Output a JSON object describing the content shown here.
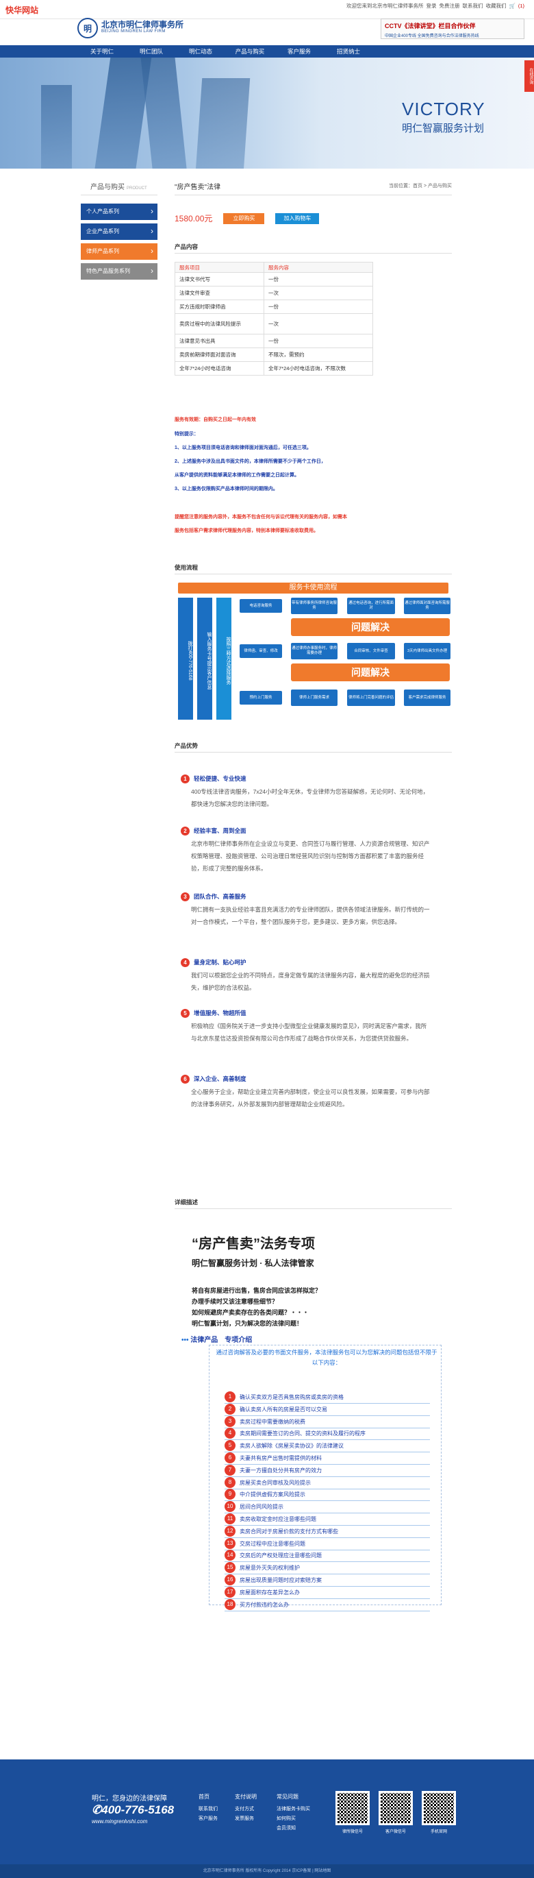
{
  "site_tag": "快华网站",
  "toplinks": [
    "欢迎您来到北京市明仁律师事务所",
    "登录",
    "免费注册",
    "联系我们",
    "收藏我们",
    "(1)"
  ],
  "logo": {
    "mark": "明",
    "cn": "北京市明仁律师事务所",
    "en": "BEIJING MINGREN LAW FIRM"
  },
  "cctv": {
    "title": "CCTV《法律讲堂》栏目合作伙伴",
    "sub": "中国企业400专线 全国免费咨询与合作法律服务热线"
  },
  "nav": [
    "关于明仁",
    "明仁团队",
    "明仁动态",
    "产品与购买",
    "客户服务",
    "招贤纳士"
  ],
  "hero": {
    "title": "VICTORY",
    "subtitle": "明仁智赢服务计划"
  },
  "side_tag": "在线咨询",
  "sidebar": {
    "title": "产品与购买",
    "title_en": "PRODUCT",
    "items": [
      "个人产品系列",
      "企业产品系列",
      "律师产品系列",
      "特色产品服务系列"
    ]
  },
  "breadcrumb": "当前位置：首页 > 产品与购买",
  "product": {
    "title": "\"房产售卖\"法律",
    "price": "1580.00元",
    "buy": "立即购买",
    "cart": "加入购物车"
  },
  "sections": {
    "content": "产品内容",
    "flow": "使用流程",
    "advantage": "产品优势",
    "detail": "详细描述"
  },
  "table": {
    "headers": [
      "服务项目",
      "服务内容"
    ],
    "rows": [
      [
        "法律文书代写",
        "一份"
      ],
      [
        "法律文件审查",
        "一次"
      ],
      [
        "买方违规时职律师函",
        "一份"
      ],
      [
        "卖房过程中的法律风险提示",
        "一次"
      ],
      [
        "法律意见书出具",
        "一份"
      ],
      [
        "卖房前期律师面对面咨询",
        "不限次，需预约"
      ],
      [
        "全年7*24小时电话咨询",
        "全年7*24小时电话咨询，不限次数"
      ]
    ]
  },
  "validity": "服务有效期：自购买之日起一年内有效",
  "notice_title": "特别提示：",
  "notices": [
    "1、以上服务项目须电话咨询和律师面对面沟通后，可任选三项。",
    "2、上述服务中涉及出具书面文件的，本律师所需要不少于两个工作日，",
    "    从客户提供的资料能够满足本律师的工作需要之日起计算。",
    "3、以上服务仅限购买产品本律师时间的期限内。"
  ],
  "disclaimer": [
    "提醒您注意的服务内容外，本服务不包含任何与诉讼代理有关的服务内容，如需本",
    "服务包括客户需求律师代理服务内容，特别本律师要标准收取费用。"
  ],
  "flow": {
    "head": "服务卡使用流程",
    "hotline": "拨打400-776-5168",
    "verify": "输入服务卡号提示客户信息",
    "center": "按照三种方式选择服务",
    "rows": [
      [
        "电话咨询服务",
        "带有律师事务所律师咨询服务",
        "通过电话咨询，进行所需面对",
        "通过律师面对面咨询所需服务"
      ],
      [
        "通过律所提交材料",
        "通过律师办事服务时，律师需要办理",
        "合同审核、文件审查",
        "3天内律师出具文件办理"
      ],
      [
        "预约上门服务",
        "律师上门服务需求",
        "律师将上门完善问题的评估",
        "客户需求完成律师服务"
      ]
    ],
    "side": [
      "文书、合同",
      "律师函、审查、修改"
    ],
    "big": "问题解决"
  },
  "advantages": [
    {
      "n": "1",
      "t": "轻松便捷、专业快速",
      "b": "400专线法律咨询服务，7x24小时全年无休，专业律师为您答疑解惑，无论何时、无论何地，都快速为您解决您的法律问题。"
    },
    {
      "n": "2",
      "t": "经验丰富、周到全面",
      "b": "北京市明仁律师事务所在企业设立与变更、合同签订与履行管理、人力资源合规管理、知识产权策略管理、投融资管理、公司治理日常经营风险识别与控制等方面都积累了丰富的服务经验，形成了完整的服务体系。"
    },
    {
      "n": "3",
      "t": "团队合作、高善服务",
      "b": "明仁拥有一支执业经验丰富且充满活力的专业律师团队，提供各领域法律服务。新打传统的一对一合作模式，一个平台，整个团队服务于您，更多建议、更多方案，供您选择。"
    },
    {
      "n": "4",
      "t": "量身定制、贴心呵护",
      "b": "我们可以根据您企业的不同特点，度身定做专属的法律服务内容，最大程度的避免您的经济损失，维护您的合法权益。"
    },
    {
      "n": "5",
      "t": "增值服务、物超所值",
      "b": "积极响应《国务院关于进一步支持小型微型企业健康发展的意见》，同时满足客户需求，我所与北京东星信达投资担保有限公司合作形成了战略合作伙伴关系，为您提供贷款服务。"
    },
    {
      "n": "6",
      "t": "深入企业、高善制度",
      "b": "全心服务于企业，帮助企业建立完善内部制度，使企业可以良性发展，如果需要，可参与内部的法律事务研究，从外部发展到内部管理帮助企业规避风险。"
    }
  ],
  "detail": {
    "heading": "“房产售卖”法务专项",
    "sub": "明仁智赢服务计划 · 私人法律管家",
    "questions": [
      "将自有房屋进行出售，售房合同应该怎样拟定？",
      "办理手续时又该注意哪些细节？",
      "如何规避房产卖卖存在的各类问题？・・・",
      "明仁智赢计划，只为解决您的法律问题！"
    ],
    "lp_title": "法律产品　专项介绍",
    "intro": "通过咨询解答及必要的书面文件服务，本法律服务包可以为您解决的问题包括但不限于以下内容：",
    "items": [
      "确认买卖双方是否具售房购房或卖房的资格",
      "确认卖房人所有的房屋是否可以交易",
      "卖房过程中需要缴纳的税费",
      "卖房期间需要签订的合同、提交的资料及履行的程序",
      "卖房人欲解除《房屋买卖协议》的法律建议",
      "夫妻共有房产出售时需提供的材料",
      "夫妻一方擅自处分共有房产的效力",
      "房屋买卖合同审核及风险提示",
      "中介提供虚假方案风险提示",
      "居间合同风险提示",
      "卖房收取定金时应注意哪些问题",
      "卖房合同对于房屋价款的支付方式有哪些",
      "交房过程中应注意哪些问题",
      "交房后的产权处理应注意哪些问题",
      "房屋意外灭失的权利维护",
      "房屋出现质量问题时应对索赔方案",
      "房屋面积存在差异怎么办",
      "买方付款违约怎么办"
    ]
  },
  "footer": {
    "slogan": "明仁，您身边的法律保障",
    "phone": "400-776-5168",
    "web": "www.mingrenlvshi.com",
    "cols": [
      {
        "h": "首页",
        "items": [
          "联系我们",
          "客户服务"
        ]
      },
      {
        "h": "支付说明",
        "items": [
          "支付方式",
          "发票服务"
        ]
      },
      {
        "h": "常见问题",
        "items": [
          "法律服务卡购买",
          "如何购买",
          "会员须知"
        ]
      }
    ],
    "qr": [
      "律所微信号",
      "客户微信号",
      "手机官网"
    ],
    "copyright": "北京市明仁律师事务所 版权所有 Copyright 2014 京ICP备案 | 网站地图"
  }
}
